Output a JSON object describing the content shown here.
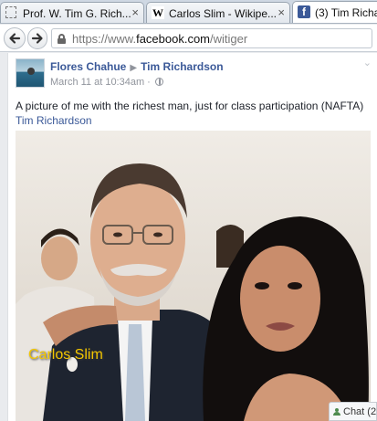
{
  "tabs": [
    {
      "title": "Prof. W. Tim G. Rich...",
      "icon": "blank-page-icon",
      "active": false
    },
    {
      "title": "Carlos Slim - Wikipe...",
      "icon": "wikipedia-icon",
      "active": false
    },
    {
      "title": "(3) Tim Richa",
      "icon": "facebook-icon",
      "active": true
    }
  ],
  "tab_close_glyph": "×",
  "icon_glyphs": {
    "wikipedia": "W",
    "facebook": "f"
  },
  "url": {
    "scheme": "https://www.",
    "host": "facebook.com",
    "path": "/witiger"
  },
  "post": {
    "author": "Flores Chahue",
    "arrow_glyph": "▶",
    "recipient": "Tim Richardson",
    "time": "March 11 at 10:34am · ",
    "caption": "A picture of me with the richest man, just for class participation (NAFTA) ",
    "caption_tag": "Tim Richardson",
    "photo_label": "Carlos Slim",
    "menu_glyph": "⌄"
  },
  "chat": {
    "label": "Chat (2"
  },
  "colors": {
    "facebook_blue": "#3b5998",
    "label_yellow": "#f3c600"
  }
}
